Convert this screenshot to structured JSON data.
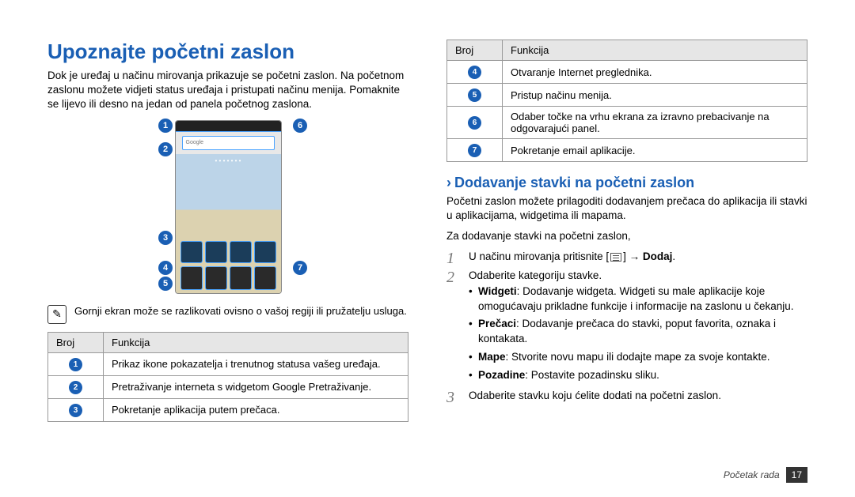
{
  "heading": "Upoznajte početni zaslon",
  "intro": "Dok je uređaj u načinu mirovanja prikazuje se početni zaslon. Na početnom zaslonu možete vidjeti status uređaja i pristupati načinu menija. Pomaknite se lijevo ili desno na jedan od panela početnog zaslona.",
  "note": "Gornji ekran može se razlikovati ovisno o vašoj regiji ili pružatelju usluga.",
  "table": {
    "headers": {
      "num": "Broj",
      "func": "Funkcija"
    },
    "left": [
      {
        "n": "1",
        "desc": "Prikaz ikone pokazatelja i trenutnog statusa vašeg uređaja."
      },
      {
        "n": "2",
        "desc": "Pretraživanje interneta s widgetom Google Pretraživanje."
      },
      {
        "n": "3",
        "desc": "Pokretanje aplikacija putem prečaca."
      }
    ],
    "right": [
      {
        "n": "4",
        "desc": "Otvaranje Internet preglednika."
      },
      {
        "n": "5",
        "desc": "Pristup načinu menija."
      },
      {
        "n": "6",
        "desc": "Odaber točke na vrhu ekrana za izravno prebacivanje na odgovarajući panel."
      },
      {
        "n": "7",
        "desc": "Pokretanje email aplikacije."
      }
    ]
  },
  "sub": {
    "heading": "Dodavanje stavki na početni zaslon",
    "p1": "Početni zaslon možete prilagoditi dodavanjem prečaca do aplikacija ili stavki u aplikacijama, widgetima ili mapama.",
    "p2": "Za dodavanje stavki na početni zaslon,",
    "step1_a": "U načinu mirovanja pritisnite [",
    "step1_b": "] → ",
    "step1_bold": "Dodaj",
    "step1_c": ".",
    "step2": "Odaberite kategoriju stavke.",
    "bullets": [
      {
        "bold": "Widgeti",
        "rest": ": Dodavanje widgeta. Widgeti su male aplikacije koje omogućavaju prikladne funkcije i informacije na zaslonu u čekanju."
      },
      {
        "bold": "Prečaci",
        "rest": ": Dodavanje prečaca do stavki, poput favorita, oznaka i kontakata."
      },
      {
        "bold": "Mape",
        "rest": ": Stvorite novu mapu ili dodajte mape za svoje kontakte."
      },
      {
        "bold": "Pozadine",
        "rest": ": Postavite pozadinsku sliku."
      }
    ],
    "step3": "Odaberite stavku koju ćelite dodati na početni zaslon."
  },
  "footer": {
    "label": "Početak rada",
    "page": "17"
  },
  "phone_search": "Google"
}
